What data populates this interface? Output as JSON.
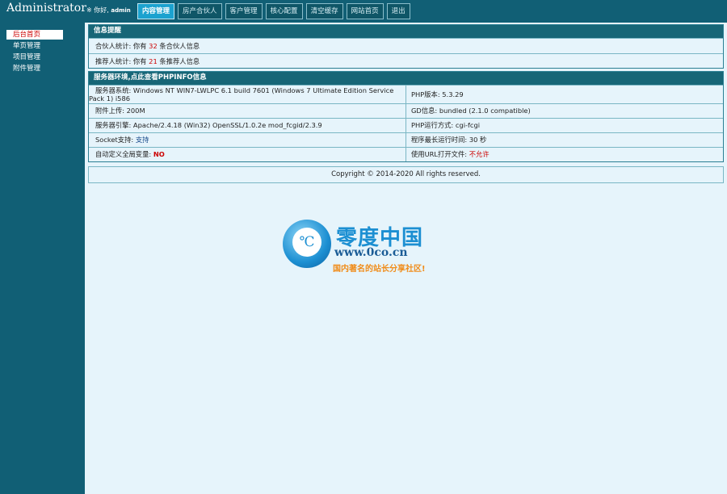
{
  "header": {
    "brand": "Administrator",
    "greeting": "※ 你好,",
    "username": "admin",
    "tabs": [
      "内容管理",
      "房产合伙人",
      "客户管理",
      "核心配置",
      "清空缓存",
      "网站首页",
      "退出"
    ]
  },
  "sidebar": {
    "items": [
      "后台首页",
      "单页管理",
      "项目管理",
      "附件管理"
    ]
  },
  "info_panel": {
    "title": "信息提醒",
    "partner_label": "合伙人统计:",
    "partner_pre": "你有",
    "partner_count": "32",
    "partner_post": "条合伙人信息",
    "referrer_label": "推荐人统计:",
    "referrer_pre": "你有",
    "referrer_count": "21",
    "referrer_post": "条推荐人信息"
  },
  "server_panel": {
    "title": "服务器环境,点此查看PHPINFO信息",
    "rows": [
      {
        "left_label": "服务器系统:",
        "left_value_1": "Windows NT WIN7-LWLPC 6.1 build 7601 (Windows 7 Ultimate Edition Service",
        "left_value_2": "Pack 1) i586",
        "right_label": "PHP版本:",
        "right_value": "5.3.29"
      },
      {
        "left_label": "附件上传:",
        "left_value": "200M",
        "right_label": "GD信息:",
        "right_value": "bundled (2.1.0 compatible)"
      },
      {
        "left_label": "服务器引擎:",
        "left_value": "Apache/2.4.18 (Win32) OpenSSL/1.0.2e mod_fcgid/2.3.9",
        "right_label": "PHP运行方式:",
        "right_value": "cgi-fcgi"
      },
      {
        "left_label": "Socket支持:",
        "left_value": "支持",
        "right_label": "程序最长运行时间:",
        "right_value": "30 秒"
      },
      {
        "left_label": "自动定义全局变量:",
        "left_value": "NO",
        "right_label": "使用URL打开文件:",
        "right_value": "不允许"
      }
    ]
  },
  "footer": {
    "copyright": "Copyright © 2014-2020 All rights reserved."
  },
  "watermark": {
    "symbol": "℃",
    "cn": "零度中国",
    "url": "www.0co.cn",
    "slogan": "国内著名的站长分享社区!"
  },
  "colors": {
    "header_bg": "#115f75",
    "panel_title_bg": "#176677",
    "active_tab": "#1ba2cf",
    "page_bg": "#e6f4fb",
    "alert_red": "#cc0000"
  }
}
